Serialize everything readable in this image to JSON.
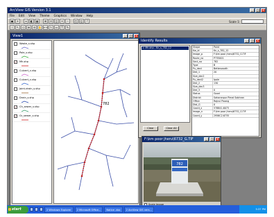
{
  "app": {
    "title": "ArcView GIS Version 3.1"
  },
  "menu": [
    "File",
    "Edit",
    "View",
    "Theme",
    "Graphics",
    "Window",
    "Help"
  ],
  "toolbar": {
    "scale_label": "Scale 1:"
  },
  "view1": {
    "title": "View1",
    "themes": [
      {
        "label": "Waste_s.shp",
        "checked": false,
        "color": "#6a6ac8"
      },
      {
        "label": "Pole_s.shp",
        "checked": false,
        "color": "#33aa33"
      },
      {
        "label": "Mh.shp",
        "checked": true,
        "color": "#cc2222"
      },
      {
        "label": "Culvert_s.shp",
        "checked": false,
        "color": "#cc66cc"
      },
      {
        "label": "Culvert_s.shp",
        "checked": false,
        "color": "#3366cc"
      },
      {
        "label": "Joint-drain_s.shp",
        "checked": false,
        "color": "#996633"
      },
      {
        "label": "Drain_s.shp",
        "checked": false,
        "color": "#2244aa"
      },
      {
        "label": "Ch_sewer_s.shp",
        "checked": true,
        "color": "#339966"
      },
      {
        "label": "Gr_sewer_s.shp",
        "checked": true,
        "color": "#cc2222"
      }
    ],
    "map_label": "782"
  },
  "identify": {
    "title": "Identify Results",
    "selected": "1: Mh.shp - Kn_s_782_12",
    "rows": [
      [
        "Shape",
        "Point"
      ],
      [
        "Kw_id",
        "Kn_s_782_12"
      ],
      [
        "Image_p",
        "F:\\km poor jheru\\6732_G.TIF"
      ],
      [
        "Route_no",
        "P735001"
      ],
      [
        "Sect_no",
        "782"
      ],
      [
        "Type",
        "B"
      ],
      [
        "Pu_dect",
        "Bettenworth"
      ],
      [
        "Diel_1",
        "20"
      ],
      [
        "Size_dec2",
        ""
      ],
      [
        "Pu_dect2",
        "Ipole"
      ],
      [
        "Diel_2",
        "130"
      ],
      [
        "Size_dec3",
        ""
      ],
      [
        "Diel_3",
        "0"
      ],
      [
        "Status",
        "Good"
      ],
      [
        "District",
        "Saharanpur Pimal Sobhran"
      ],
      [
        "Office",
        "Rajnui Pwang"
      ],
      [
        "Dist_G",
        "0"
      ],
      [
        "Coord_x",
        "578841.6073"
      ],
      [
        "Image_n",
        "F:\\km poor jheru\\6732_G.TIF"
      ],
      [
        "Coord_y",
        "2956C2.6735"
      ]
    ],
    "clear_label": "Clear",
    "clear_all_label": "Clear All"
  },
  "photo": {
    "title": "F:\\km poor jheru\\6732_G.TIF",
    "scale_label": "Scale Image",
    "marker_text": "782"
  },
  "taskbar": {
    "start": "start",
    "tasks": [
      "2 Windows Explorer",
      "2 Microsoft Office...",
      "Notice .doc",
      "2 ArcView GIS vers..."
    ],
    "clock": "5:37 PM"
  }
}
